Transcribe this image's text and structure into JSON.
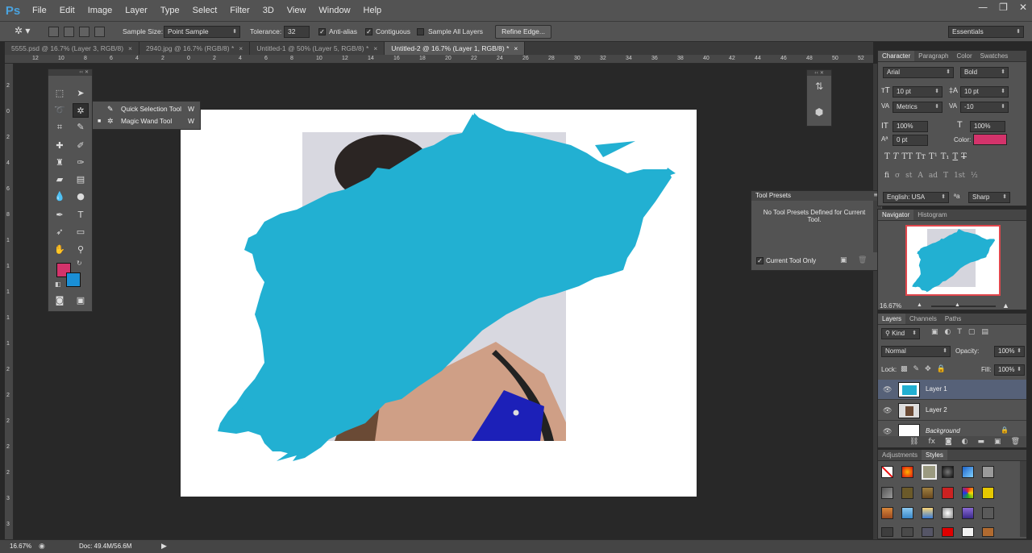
{
  "app": {
    "logo": "Ps"
  },
  "menu": [
    "File",
    "Edit",
    "Image",
    "Layer",
    "Type",
    "Select",
    "Filter",
    "3D",
    "View",
    "Window",
    "Help"
  ],
  "window_controls": {
    "minimize": "—",
    "restore": "❐",
    "close": "✕"
  },
  "options": {
    "sample_size_label": "Sample Size:",
    "sample_size_value": "Point Sample",
    "tolerance_label": "Tolerance:",
    "tolerance_value": "32",
    "antialias_label": "Anti-alias",
    "antialias_checked": true,
    "contiguous_label": "Contiguous",
    "contiguous_checked": true,
    "sample_all_label": "Sample All Layers",
    "sample_all_checked": false,
    "refine_edge": "Refine Edge...",
    "workspace": "Essentials"
  },
  "tabs": [
    {
      "label": "5555.psd @ 16.7% (Layer 3, RGB/8)",
      "close": "×"
    },
    {
      "label": "2940.jpg @ 16.7% (RGB/8) *",
      "close": "×"
    },
    {
      "label": "Untitled-1 @ 50% (Layer 5, RGB/8) *",
      "close": "×"
    },
    {
      "label": "Untitled-2 @ 16.7% (Layer 1, RGB/8) *",
      "close": "×"
    }
  ],
  "ruler_h": [
    "12",
    "10",
    "8",
    "6",
    "4",
    "2",
    "0",
    "2",
    "4",
    "6",
    "8",
    "10",
    "12",
    "14",
    "16",
    "18",
    "20",
    "22",
    "24",
    "26",
    "28",
    "30",
    "32",
    "34",
    "36",
    "38",
    "40",
    "42",
    "44",
    "46",
    "48",
    "50",
    "52"
  ],
  "ruler_v": [
    "2",
    "0",
    "2",
    "4",
    "6",
    "8",
    "1",
    "1",
    "1",
    "1",
    "1",
    "2",
    "2",
    "2",
    "2",
    "2",
    "3",
    "3",
    "3"
  ],
  "flyout": [
    {
      "label": "Quick Selection Tool",
      "key": "W",
      "icon": "quick-selection-icon",
      "active": false
    },
    {
      "label": "Magic Wand Tool",
      "key": "W",
      "icon": "magic-wand-icon",
      "active": true
    }
  ],
  "colors": {
    "foreground": "#d4336b",
    "background": "#1a8fd6",
    "splash": "#22b0d2",
    "blue_top": "#1c20b8"
  },
  "tool_presets": {
    "title": "Tool Presets",
    "message": "No Tool Presets Defined for Current Tool.",
    "current_tool_only": "Current Tool Only"
  },
  "character": {
    "tabs": [
      "Character",
      "Paragraph",
      "Color",
      "Swatches"
    ],
    "font": "Arial",
    "style": "Bold",
    "size": "10 pt",
    "leading": "10 pt",
    "kerning": "Metrics",
    "tracking": "-10",
    "vscale": "100%",
    "hscale": "100%",
    "baseline": "0 pt",
    "color_label": "Color:",
    "language": "English: USA",
    "aa_label": "a",
    "antialias": "Sharp",
    "style_buttons": [
      "T",
      "T",
      "TT",
      "Tт",
      "T¹",
      "T₁",
      "T",
      "T"
    ],
    "ot_buttons": [
      "fi",
      "σ",
      "st",
      "A",
      "ad",
      "T",
      "1st",
      "½"
    ]
  },
  "navigator": {
    "tabs": [
      "Navigator",
      "Histogram"
    ],
    "zoom": "16.67%"
  },
  "layers": {
    "tabs": [
      "Layers",
      "Channels",
      "Paths"
    ],
    "filter": "Kind",
    "blend_mode": "Normal",
    "opacity_label": "Opacity:",
    "opacity": "100%",
    "lock_label": "Lock:",
    "fill_label": "Fill:",
    "fill": "100%",
    "items": [
      {
        "name": "Layer 1",
        "selected": true
      },
      {
        "name": "Layer 2",
        "selected": false
      },
      {
        "name": "Background",
        "selected": false
      }
    ]
  },
  "styles_panel": {
    "tabs": [
      "Adjustments",
      "Styles"
    ]
  },
  "status": {
    "zoom": "16.67%",
    "doc": "Doc: 49.4M/56.6M"
  }
}
